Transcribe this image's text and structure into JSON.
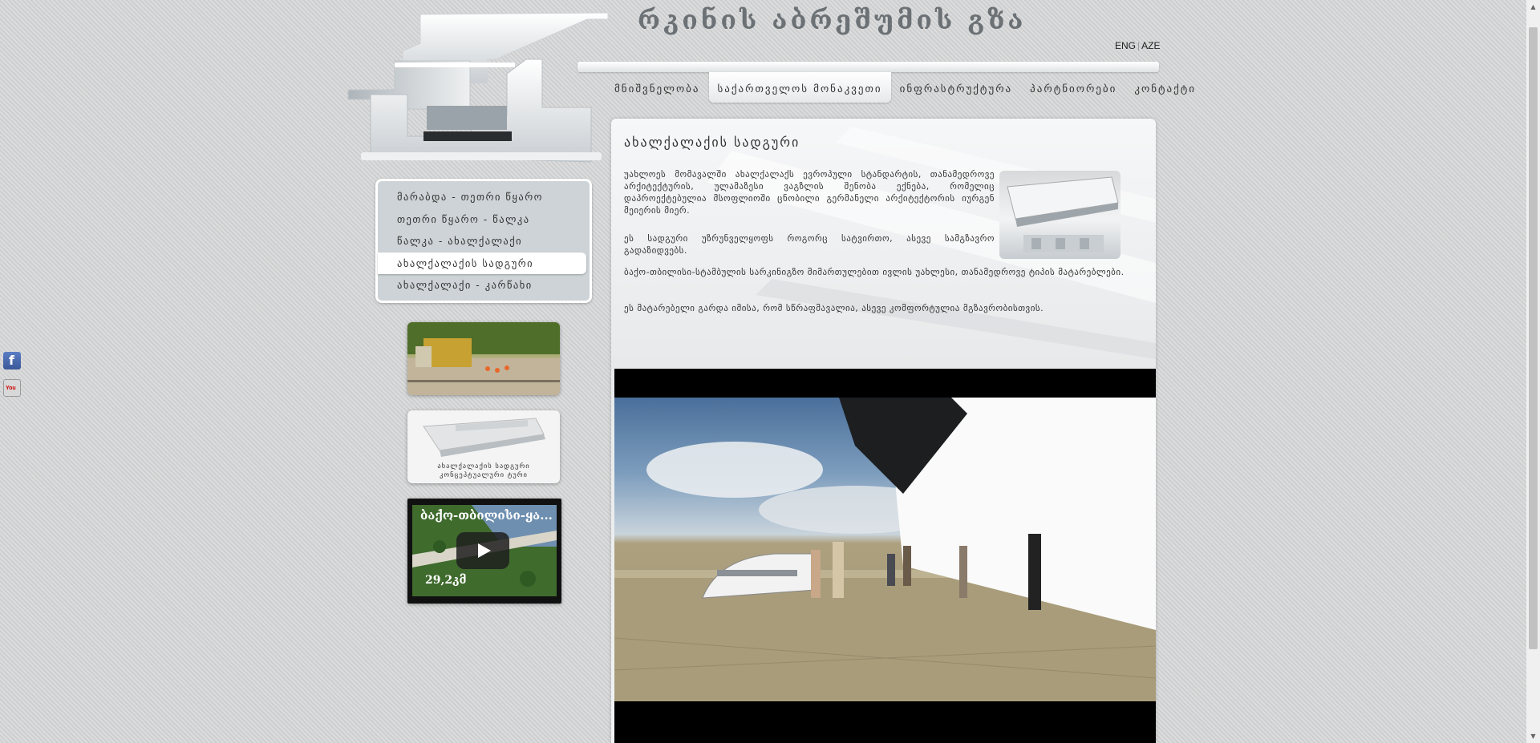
{
  "site": {
    "title": "რკინის აბრეშუმის გზა"
  },
  "lang": {
    "eng": "ENG",
    "aze": "AZE"
  },
  "nav": [
    {
      "label": "მნიშვნელობა"
    },
    {
      "label": "საქართველოს მონაკვეთი"
    },
    {
      "label": "ინფრასტრუქტურა"
    },
    {
      "label": "პარტნიორები"
    },
    {
      "label": "კონტაქტი"
    }
  ],
  "side_menu": [
    {
      "label": "მარაბდა - თეთრი წყარო"
    },
    {
      "label": "თეთრი წყარო - წალკა"
    },
    {
      "label": "წალკა - ახალქალაქი"
    },
    {
      "label": "ახალქალაქის სადგური"
    },
    {
      "label": "ახალქალაქი - კარწახი"
    }
  ],
  "thumbs": {
    "station_caption_1": "ახალქალაქის სადგური",
    "station_caption_2": "კონცეპტუალური ტური",
    "video_title": "ბაქო-თბილისი-ყა...",
    "video_time": "29,2კმ"
  },
  "content": {
    "title": "ახალქალაქის სადგური",
    "p1": "უახლოეს მომავალში ახალქალაქს ევროპული სტანდარტის, თანამედროვე არქიტექტურის, ულამაზესი ვაგზლის შენობა ექნება, რომელიც დაპროექტებულია მსოფლიოში ცნობილი გერმანელი არქიტექტორის იურგენ მეიერის მიერ.",
    "p2": "ეს სადგური უზრუნველყოფს როგორც სატვირთო, ასევე სამგზავრო გადაზიდვებს.",
    "p3": "ბაქო-თბილისი-სტამბულის სარკინიგზო მიმართულებით ივლის უახლესი, თანამედროვე ტიპის მატარებლები.",
    "p4": "ეს მატარებელი გარდა იმისა, რომ სწრაფმავალია, ასევე კომფორტულია მგზავრობისთვის."
  }
}
